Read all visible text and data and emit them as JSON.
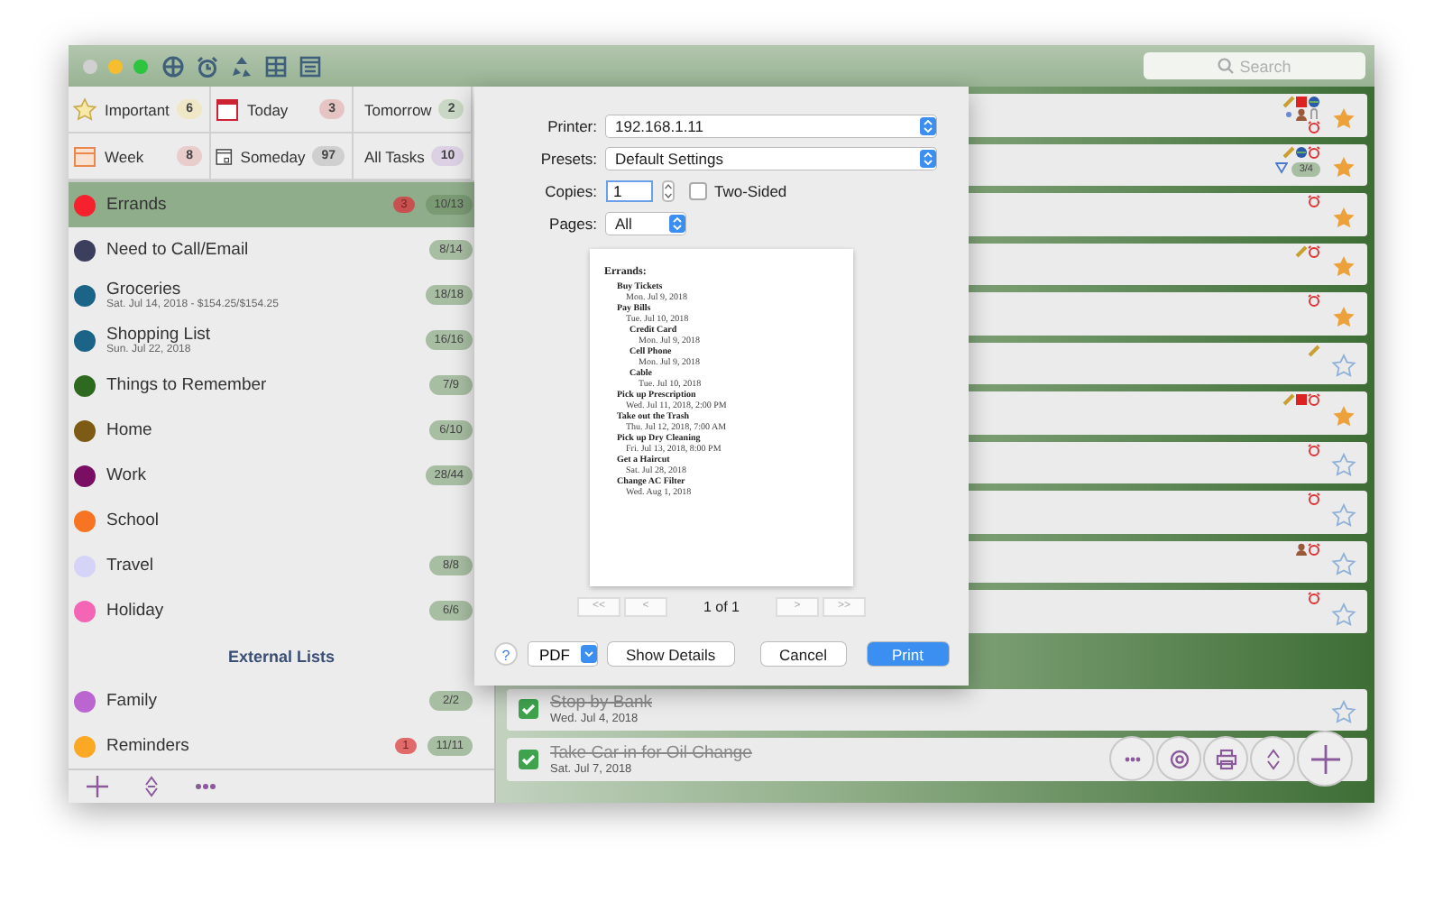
{
  "window": {
    "search_placeholder": "Search"
  },
  "smart_lists": [
    {
      "kind": "star",
      "label": "Important",
      "count": "6",
      "color": "#efe7c6"
    },
    {
      "kind": "today",
      "label": "Today",
      "count": "3",
      "color": "#e6c4c4"
    },
    {
      "kind": "tomorrow",
      "label": "Tomorrow",
      "count": "2",
      "color": "#c9d8c4"
    },
    {
      "kind": "week",
      "label": "Week",
      "count": "8",
      "color": "#e9cccc"
    },
    {
      "kind": "someday",
      "label": "Someday",
      "count": "97",
      "color": "#cfcfcf"
    },
    {
      "kind": "all",
      "label": "All Tasks",
      "count": "10",
      "color": "#dcd0e4"
    }
  ],
  "lists": [
    {
      "kind": "list",
      "name": "Errands",
      "color": "#f5222d",
      "alert": "3",
      "count": "10/13",
      "selected": true
    },
    {
      "kind": "list",
      "name": "Need to Call/Email",
      "color": "#3c3e5e",
      "count": "8/14",
      "selected": false
    },
    {
      "kind": "list",
      "name": "Groceries",
      "subtitle": "Sat. Jul 14, 2018 - $154.25/$154.25",
      "color": "#1b6487",
      "count": "18/18",
      "selected": false
    },
    {
      "kind": "list",
      "name": "Shopping List",
      "subtitle": "Sun. Jul 22, 2018",
      "color": "#1b6487",
      "count": "16/16",
      "selected": false
    },
    {
      "kind": "list",
      "name": "Things to Remember",
      "color": "#2d6a1f",
      "count": "7/9",
      "selected": false
    },
    {
      "kind": "list",
      "name": "Home",
      "color": "#7e5b14",
      "count": "6/10",
      "selected": false
    },
    {
      "kind": "list",
      "name": "Work",
      "color": "#7a0e63",
      "count": "28/44",
      "selected": false
    },
    {
      "kind": "list",
      "name": "School",
      "color": "#f77522",
      "selected": false
    },
    {
      "kind": "list",
      "name": "Travel",
      "color": "#d5d3f7",
      "count": "8/8",
      "selected": false
    },
    {
      "kind": "list",
      "name": "Holiday",
      "color": "#f565b6",
      "count": "6/6",
      "selected": false
    },
    {
      "kind": "header",
      "name": "External Lists"
    },
    {
      "kind": "list",
      "name": "Family",
      "color": "#bb66d0",
      "count": "2/2",
      "selected": false
    },
    {
      "kind": "list",
      "name": "Reminders",
      "color": "#fba924",
      "alert": "1",
      "count": "11/11",
      "selected": false
    }
  ],
  "tasks": [
    {
      "starred": true,
      "note": true,
      "event": true,
      "location": true,
      "repeat": true,
      "contact": true,
      "attachment": true,
      "alarm": true
    },
    {
      "starred": true,
      "note": true,
      "location": true,
      "alarm": true,
      "expanded": false,
      "progress": "3/4"
    },
    {
      "starred": true,
      "alarm": true
    },
    {
      "starred": true,
      "note": true,
      "alarm": true
    },
    {
      "starred": true,
      "alarm": true
    },
    {
      "starred": false,
      "note": true
    },
    {
      "starred": true,
      "note": true,
      "event": true,
      "alarm": true
    },
    {
      "starred": false,
      "alarm": true
    },
    {
      "starred": false,
      "alarm": true
    },
    {
      "starred": false,
      "contact": true,
      "alarm": true
    },
    {
      "starred": false,
      "alarm": true
    }
  ],
  "completed_tasks": [
    {
      "title": "Stop by Bank",
      "date": "Wed. Jul 4, 2018",
      "done": true,
      "starred": false
    },
    {
      "title": "Take Car in for Oil Change",
      "date": "Sat. Jul 7, 2018",
      "done": true
    }
  ],
  "print_dialog": {
    "fields": [
      {
        "label": "Printer:",
        "value": "192.168.1.11"
      },
      {
        "label": "Presets:",
        "value": "Default Settings"
      }
    ],
    "copies_label": "Copies:",
    "copies": "1",
    "two_sided_label": "Two-Sided",
    "two_sided": false,
    "pages_label": "Pages:",
    "pages": "All",
    "preview": {
      "heading": "Errands:",
      "items": [
        {
          "title": "Buy Tickets",
          "date": "Mon. Jul 9, 2018"
        },
        {
          "title": "Pay Bills",
          "date": "Tue. Jul 10, 2018",
          "children": [
            {
              "title": "Credit Card",
              "date": "Mon. Jul 9, 2018"
            },
            {
              "title": "Cell Phone",
              "date": "Mon. Jul 9, 2018"
            },
            {
              "title": "Cable",
              "date": "Tue. Jul 10, 2018"
            }
          ]
        },
        {
          "title": "Pick up Prescription",
          "date": "Wed. Jul 11, 2018, 2:00 PM"
        },
        {
          "title": "Take out the Trash",
          "date": "Thu. Jul 12, 2018, 7:00 AM"
        },
        {
          "title": "Pick up Dry Cleaning",
          "date": "Fri. Jul 13, 2018, 8:00 PM"
        },
        {
          "title": "Get a Haircut",
          "date": "Sat. Jul 28, 2018"
        },
        {
          "title": "Change AC Filter",
          "date": "Wed. Aug 1, 2018"
        }
      ]
    },
    "nav": [
      "<<",
      "<",
      "1 of 1",
      ">",
      ">>"
    ],
    "help": "?",
    "pdf": "PDF",
    "show_details": "Show Details",
    "cancel": "Cancel",
    "print": "Print"
  }
}
